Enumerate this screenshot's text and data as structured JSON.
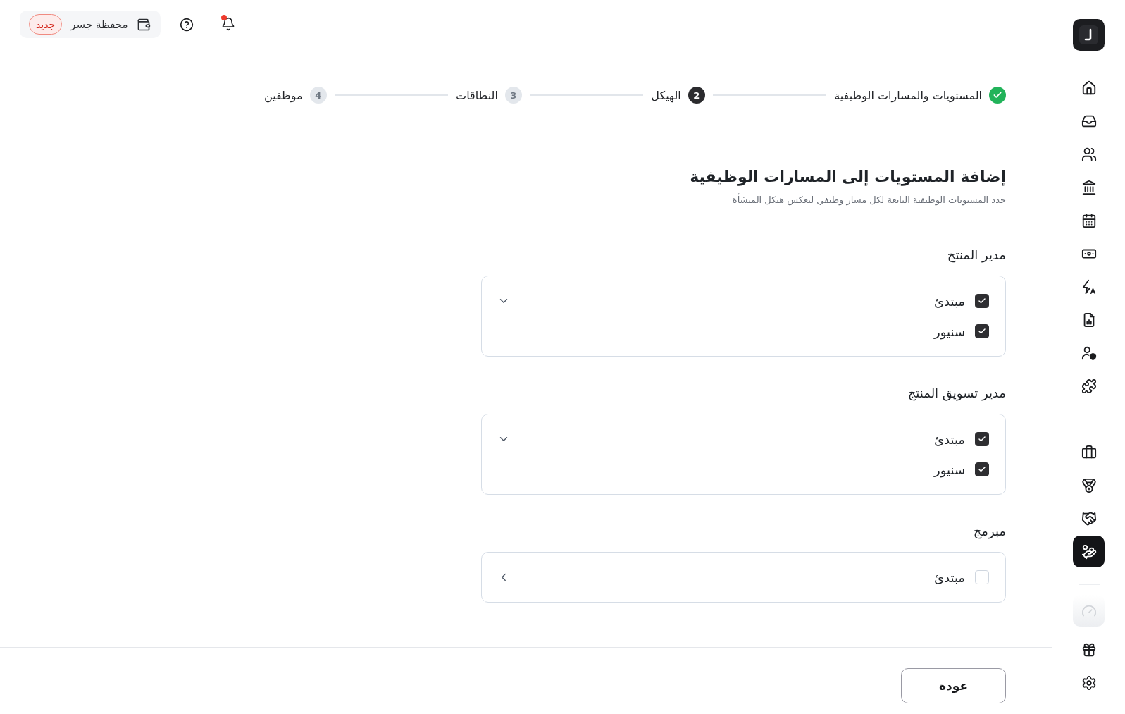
{
  "sidebar": {
    "groups": [
      {
        "items": [
          {
            "selected": false,
            "disabled": false
          },
          {
            "selected": false,
            "disabled": false
          },
          {
            "selected": false,
            "disabled": false
          },
          {
            "selected": false,
            "disabled": false
          },
          {
            "selected": false,
            "disabled": false
          },
          {
            "selected": false,
            "disabled": false
          },
          {
            "selected": false,
            "disabled": false
          },
          {
            "selected": false,
            "disabled": false
          },
          {
            "selected": false,
            "disabled": false
          },
          {
            "selected": false,
            "disabled": false
          }
        ]
      },
      {
        "items": [
          {
            "selected": false,
            "disabled": false
          },
          {
            "selected": false,
            "disabled": false
          },
          {
            "selected": false,
            "disabled": false
          },
          {
            "selected": true,
            "disabled": false
          }
        ]
      },
      {
        "items": [
          {
            "selected": false,
            "disabled": true
          },
          {
            "selected": false,
            "disabled": false
          },
          {
            "selected": false,
            "disabled": false
          }
        ]
      }
    ]
  },
  "top_bar": {
    "notifications": {
      "unread": true
    },
    "wallet": {
      "label": "محفظة جسر",
      "badge": "جديد"
    }
  },
  "stepper": [
    {
      "label": "المستويات والمسارات الوظيفية",
      "completed": true,
      "selected": false
    },
    {
      "label": "الهيكل",
      "number": "2",
      "completed": false,
      "selected": true
    },
    {
      "label": "النطاقات",
      "number": "3",
      "completed": false,
      "selected": false
    },
    {
      "label": "موظفين",
      "number": "4",
      "completed": false,
      "selected": false
    }
  ],
  "heading": {
    "title": "إضافة المستويات إلى المسارات الوظيفية",
    "subtitle": "حدد المستويات الوظيفية التابعة لكل مسار وظيفي لتعكس هيكل المنشأة"
  },
  "tracks": [
    {
      "name": "مدير المنتج",
      "expanded": true,
      "levels": [
        {
          "label": "مبتدئ",
          "checked": true
        },
        {
          "label": "سنيور",
          "checked": true
        }
      ]
    },
    {
      "name": "مدير تسويق المنتج",
      "expanded": true,
      "levels": [
        {
          "label": "مبتدئ",
          "checked": true
        },
        {
          "label": "سنيور",
          "checked": true
        }
      ]
    },
    {
      "name": "مبرمج",
      "expanded": false,
      "levels": [
        {
          "label": "مبتدئ",
          "checked": false
        }
      ]
    }
  ],
  "footer": {
    "back_button": "عودة"
  }
}
